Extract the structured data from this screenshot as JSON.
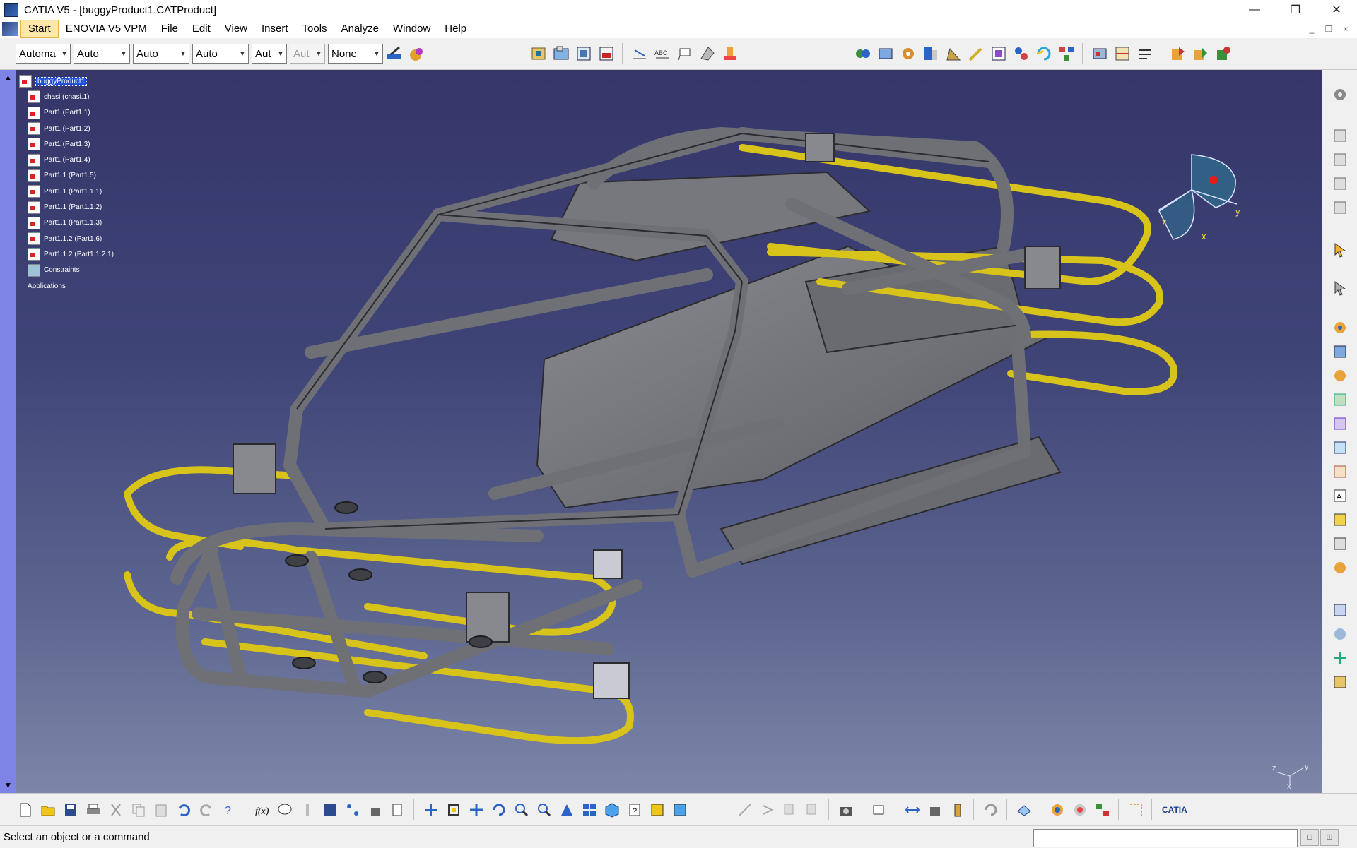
{
  "window": {
    "title": "CATIA V5 - [buggyProduct1.CATProduct]",
    "controls": {
      "minimize": "—",
      "restore": "❐",
      "close": "✕"
    }
  },
  "menubar": {
    "items": [
      "Start",
      "ENOVIA V5 VPM",
      "File",
      "Edit",
      "View",
      "Insert",
      "Tools",
      "Analyze",
      "Window",
      "Help"
    ],
    "active": "Start",
    "mdi_controls": [
      "_",
      "❐",
      "×"
    ]
  },
  "toolbar_top": {
    "combos": [
      {
        "value": "Automa",
        "disabled": false
      },
      {
        "value": "Auto",
        "disabled": false
      },
      {
        "value": "Auto",
        "disabled": false
      },
      {
        "value": "Auto",
        "disabled": false
      },
      {
        "value": "Aut",
        "disabled": false
      },
      {
        "value": "Aut",
        "disabled": true
      },
      {
        "value": "None",
        "disabled": false
      }
    ],
    "icons": [
      "paintbrush-icon",
      "color-picker-icon",
      "catalog-icon",
      "product-icon",
      "component-icon",
      "part-icon",
      "dimension-icon",
      "text-abc-icon",
      "flag-note-icon",
      "annotation-icon",
      "stamp-icon",
      "assembly-constraint-icon",
      "fix-icon",
      "contact-icon",
      "offset-icon",
      "angle-icon",
      "pencil-icon",
      "manipulate-icon",
      "snap-icon",
      "refresh-icon",
      "explode-icon",
      "clash-icon",
      "sectioning-icon",
      "distance-icon",
      "bom-icon",
      "scene-icon",
      "publish-icon"
    ]
  },
  "tree": {
    "root": "buggyProduct1",
    "nodes": [
      "chasi (chasi.1)",
      "Part1 (Part1.1)",
      "Part1 (Part1.2)",
      "Part1 (Part1.3)",
      "Part1 (Part1.4)",
      "Part1.1 (Part1.5)",
      "Part1.1 (Part1.1.1)",
      "Part1.1 (Part1.1.2)",
      "Part1.1 (Part1.1.3)",
      "Part1.1.2 (Part1.6)",
      "Part1.1.2 (Part1.1.2.1)"
    ],
    "constraints": "Constraints",
    "applications": "Applications"
  },
  "compass": {
    "x": "x",
    "y": "y",
    "z": "z"
  },
  "axis_indicator": {
    "x": "x",
    "y": "y",
    "z": "z"
  },
  "colors": {
    "viewport_top": "#35366a",
    "viewport_bottom": "#7d86a8",
    "tube_gray": "#7a7a80",
    "tube_yellow": "#d8c31a",
    "selection": "#1f4fd6"
  },
  "right_toolbar": {
    "icons": [
      "gear-assembly-icon",
      "pad-icon",
      "pocket-icon",
      "shaft-icon",
      "groove-icon",
      "select-arrow-icon",
      "select-hand-icon",
      "new-component-icon",
      "new-product-icon",
      "new-part-icon",
      "existing-component-icon",
      "replace-component-icon",
      "graph-tree-icon",
      "reorder-icon",
      "renumber-icon",
      "generate-numbering-icon",
      "multi-instantiate-icon",
      "fast-multi-instantiate-icon",
      "snap-move-icon",
      "explode-view-icon",
      "stop-manipulate-icon",
      "reuse-pattern-icon"
    ]
  },
  "bottom_toolbar": {
    "icons": [
      "new-file-icon",
      "open-icon",
      "save-icon",
      "print-icon",
      "cut-icon",
      "copy-icon",
      "paste-icon",
      "undo-icon",
      "redo-icon",
      "whats-this-icon",
      "formula-fx-icon",
      "knowledge-icon",
      "parameters-icon",
      "table-icon",
      "design-table-icon",
      "lock-icon",
      "catalog-browser-icon",
      "fly-mode-icon",
      "fit-all-icon",
      "pan-icon",
      "rotate-icon",
      "zoom-in-icon",
      "zoom-out-icon",
      "normal-view-icon",
      "multi-view-icon",
      "iso-view-icon",
      "view-mode-icon",
      "hide-show-icon",
      "swap-space-icon",
      "measure-icon",
      "reconnect-icon",
      "copy-paste-special-icon",
      "capture-icon",
      "camera-icon",
      "distance-measure-icon",
      "mass-icon",
      "bottle-icon",
      "update-icon",
      "plane-icon",
      "weld-icon",
      "material-icon",
      "apply-material-icon",
      "grid-icon"
    ],
    "brand": "CATIA"
  },
  "statusbar": {
    "message": "Select an object or a command",
    "command_input": ""
  }
}
